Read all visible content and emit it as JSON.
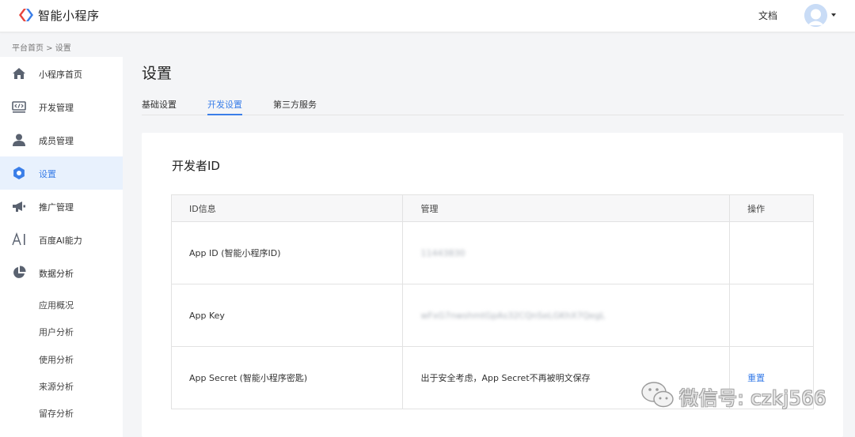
{
  "app": {
    "brand": "智能小程序",
    "docs_label": "文档",
    "logo_icon": "smart-program-logo",
    "brand_colors": [
      "#e8453c",
      "#3a7ee8"
    ]
  },
  "breadcrumb": "平台首页 > 设置",
  "sidebar": {
    "items": [
      {
        "label": "小程序首页",
        "icon": "home-icon"
      },
      {
        "label": "开发管理",
        "icon": "code-icon"
      },
      {
        "label": "成员管理",
        "icon": "user-icon"
      },
      {
        "label": "设置",
        "icon": "settings-icon",
        "active": true
      },
      {
        "label": "推广管理",
        "icon": "megaphone-icon"
      },
      {
        "label": "百度AI能力",
        "icon": "ai-icon"
      },
      {
        "label": "数据分析",
        "icon": "pie-chart-icon"
      }
    ],
    "sub_items": [
      "应用概况",
      "用户分析",
      "使用分析",
      "来源分析",
      "留存分析"
    ]
  },
  "page": {
    "title": "设置",
    "tabs": [
      {
        "label": "基础设置"
      },
      {
        "label": "开发设置",
        "active": true
      },
      {
        "label": "第三方服务"
      }
    ]
  },
  "section": {
    "title": "开发者ID",
    "headers": [
      "ID信息",
      "管理",
      "操作"
    ],
    "rows": [
      {
        "info": "App ID (智能小程序ID)",
        "value": "11443830",
        "action": ""
      },
      {
        "info": "App Key",
        "value": "wFxG7nwshmtGpAs32CQnSeLGKhX7QegL",
        "action": ""
      },
      {
        "info": "App Secret (智能小程序密匙)",
        "value": "出于安全考虑，App Secret不再被明文保存",
        "action": "重置"
      }
    ]
  },
  "watermark": {
    "text": "微信号: czkj566",
    "icon": "wechat-icon"
  },
  "colors": {
    "accent": "#3a7ee8",
    "active_bg": "#e8f1fd",
    "page_bg": "#f4f5f7"
  }
}
